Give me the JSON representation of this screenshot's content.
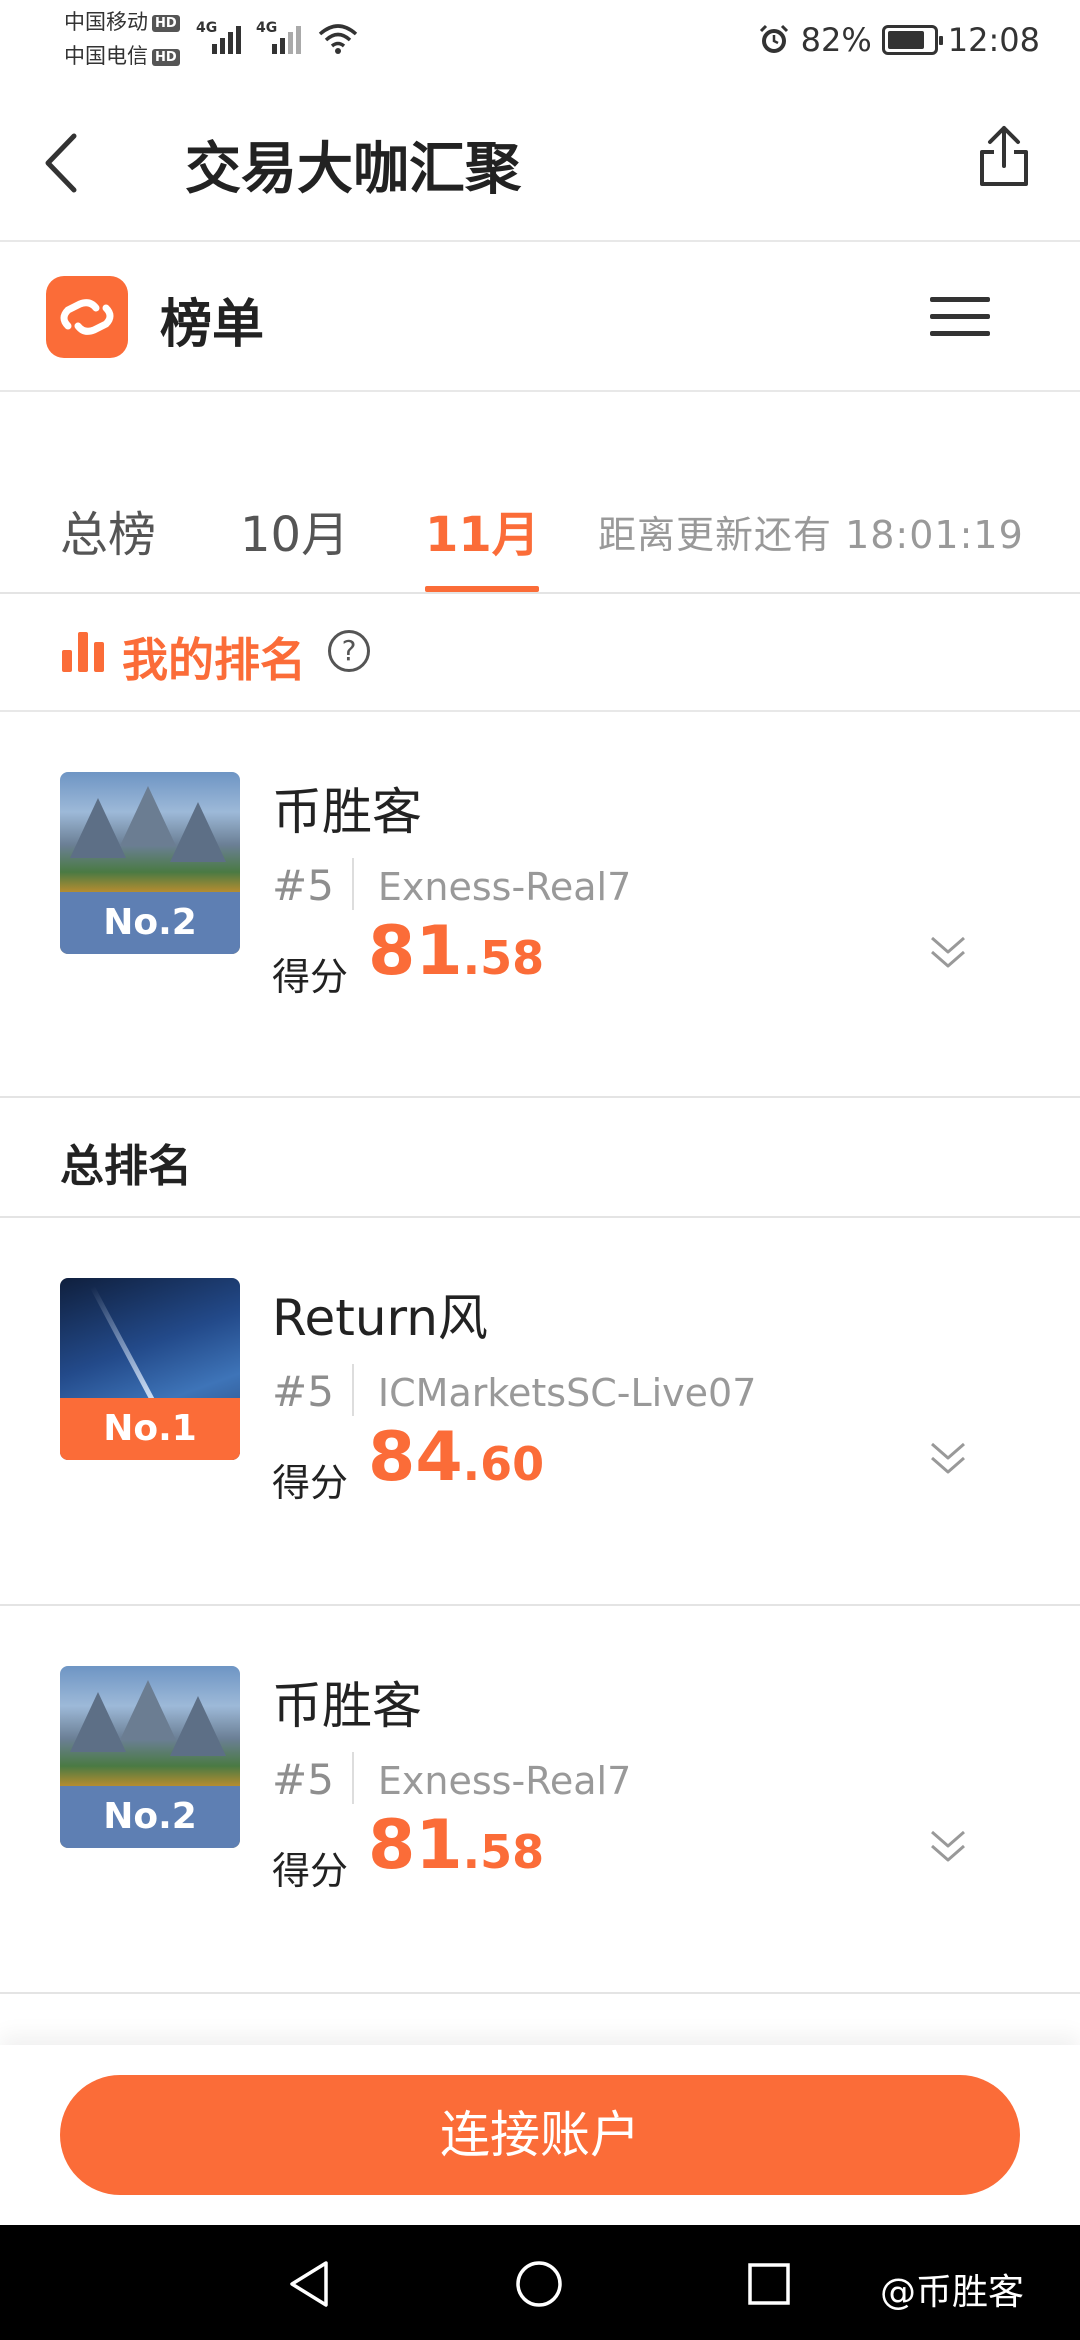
{
  "status_bar": {
    "carrier1": "中国移动",
    "carrier2": "中国电信",
    "hd": "HD",
    "network": "4G",
    "battery": "82%",
    "battery_fraction": 0.82,
    "time": "12:08"
  },
  "header": {
    "title": "交易大咖汇聚"
  },
  "subheader": {
    "title": "榜单"
  },
  "tabs": [
    {
      "label": "总榜",
      "active": false
    },
    {
      "label": "10月",
      "active": false
    },
    {
      "label": "11月",
      "active": true
    }
  ],
  "countdown": "距离更新还有 18:01:19",
  "my_rank": {
    "label": "我的排名",
    "help": "?",
    "entry": {
      "badge": "No.2",
      "name": "币胜客",
      "position": "#5",
      "account": "Exness-Real7",
      "score_label": "得分",
      "score_int": "81",
      "score_dec": ".58"
    }
  },
  "total": {
    "label": "总排名",
    "entries": [
      {
        "badge": "No.1",
        "name": "Return风",
        "position": "#5",
        "account": "ICMarketsSC-Live07",
        "score_label": "得分",
        "score_int": "84",
        "score_dec": ".60"
      },
      {
        "badge": "No.2",
        "name": "币胜客",
        "position": "#5",
        "account": "Exness-Real7",
        "score_label": "得分",
        "score_int": "81",
        "score_dec": ".58"
      }
    ]
  },
  "connect_button": "连接账户",
  "watermark": "@币胜客",
  "colors": {
    "accent": "#fb6c38",
    "badge_blue": "#5e7fb3"
  }
}
